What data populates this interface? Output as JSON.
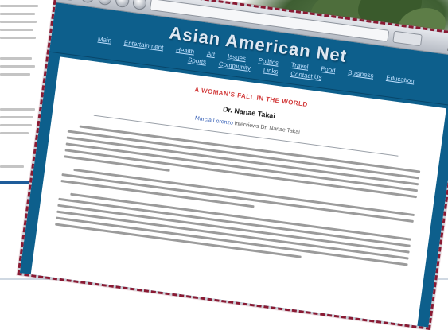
{
  "window": {
    "site_title": "Asian American Net",
    "nav_items": [
      "Main",
      "Entertainment",
      "Health",
      "Art",
      "Issues",
      "Politics",
      "Travel",
      "Food",
      "Business",
      "Education",
      "Sports",
      "Community",
      "Links",
      "Contact Us"
    ]
  },
  "article": {
    "heading": "A WOMAN'S FALL IN THE WORLD",
    "byline": "Dr. Nanae Takai",
    "credit_link": "Marcia Lorenzo",
    "credit_rest": " interviews Dr. Nanae Takai"
  },
  "colors": {
    "header": "#0d5f8c",
    "dashed_border": "#8a1a33",
    "heading_red": "#d23a3a"
  }
}
